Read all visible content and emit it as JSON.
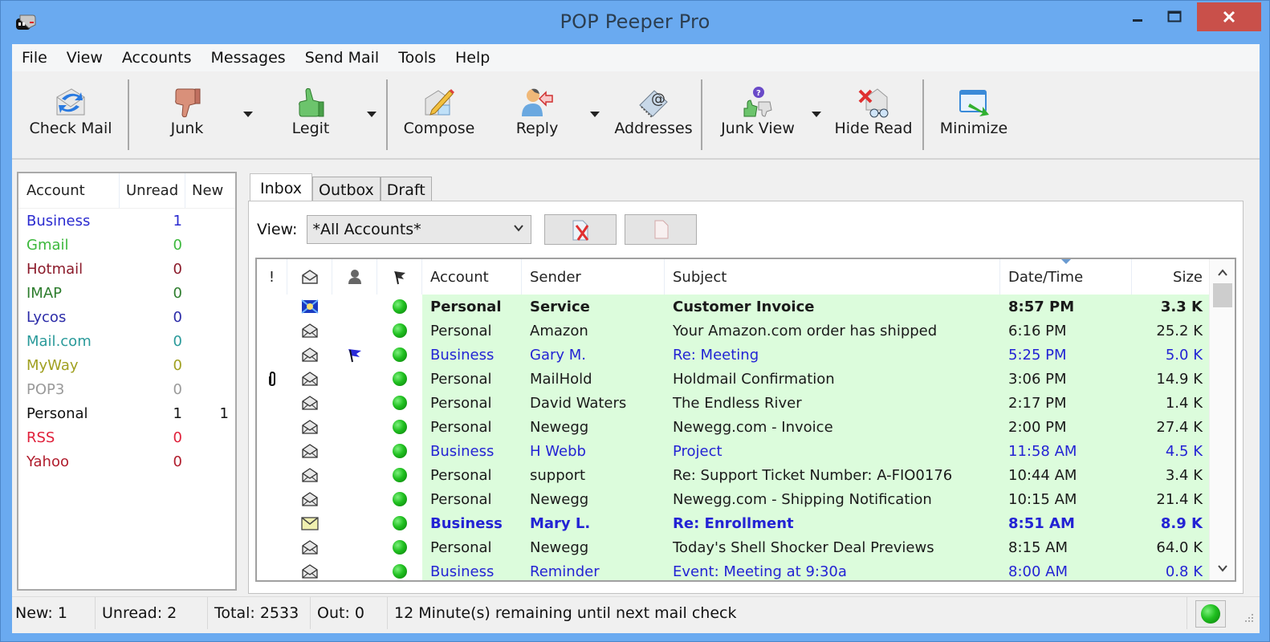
{
  "window": {
    "title": "POP Peeper Pro",
    "controls": {
      "minimize": "minimize",
      "maximize": "maximize",
      "close": "close"
    }
  },
  "menu": [
    "File",
    "View",
    "Accounts",
    "Messages",
    "Send Mail",
    "Tools",
    "Help"
  ],
  "toolbar": {
    "buttons": [
      {
        "label": "Check Mail",
        "icon": "check-mail-icon"
      },
      {
        "label": "Junk",
        "icon": "thumbs-down-icon",
        "dropdown": true
      },
      {
        "label": "Legit",
        "icon": "thumbs-up-icon",
        "dropdown": true
      },
      {
        "label": "Compose",
        "icon": "compose-icon"
      },
      {
        "label": "Reply",
        "icon": "reply-icon",
        "dropdown": true
      },
      {
        "label": "Addresses",
        "icon": "address-book-icon"
      },
      {
        "label": "Junk View",
        "icon": "junk-view-icon",
        "dropdown": true
      },
      {
        "label": "Hide Read",
        "icon": "hide-read-icon"
      },
      {
        "label": "Minimize",
        "icon": "minimize-to-tray-icon"
      }
    ]
  },
  "accounts_panel": {
    "headers": {
      "account": "Account",
      "unread": "Unread",
      "new": "New"
    },
    "rows": [
      {
        "name": "Business",
        "unread": "1",
        "new": "",
        "color": "#2b2bd0"
      },
      {
        "name": "Gmail",
        "unread": "0",
        "new": "",
        "color": "#3cb83c"
      },
      {
        "name": "Hotmail",
        "unread": "0",
        "new": "",
        "color": "#8b1a2a"
      },
      {
        "name": "IMAP",
        "unread": "0",
        "new": "",
        "color": "#2e7d2e"
      },
      {
        "name": "Lycos",
        "unread": "0",
        "new": "",
        "color": "#2b2ba8"
      },
      {
        "name": "Mail.com",
        "unread": "0",
        "new": "",
        "color": "#2a9a9a"
      },
      {
        "name": "MyWay",
        "unread": "0",
        "new": "",
        "color": "#a0a020"
      },
      {
        "name": "POP3",
        "unread": "0",
        "new": "",
        "color": "#9a9a9a"
      },
      {
        "name": "Personal",
        "unread": "1",
        "new": "1",
        "color": "#111111"
      },
      {
        "name": "RSS",
        "unread": "0",
        "new": "",
        "color": "#e0203a"
      },
      {
        "name": "Yahoo",
        "unread": "0",
        "new": "",
        "color": "#b01c2c"
      }
    ]
  },
  "tabs": [
    {
      "label": "Inbox",
      "active": true
    },
    {
      "label": "Outbox",
      "active": false
    },
    {
      "label": "Draft",
      "active": false
    }
  ],
  "view": {
    "label": "View:",
    "selected": "*All Accounts*"
  },
  "view_buttons": [
    {
      "icon": "delete-message-icon"
    },
    {
      "icon": "blank-page-icon"
    }
  ],
  "grid": {
    "headers": {
      "priority": "!",
      "status": "envelope-icon",
      "person": "person-icon",
      "flag": "flag-icon",
      "account": "Account",
      "sender": "Sender",
      "subject": "Subject",
      "date": "Date/Time",
      "size": "Size"
    },
    "sort_column": "date",
    "rows": [
      {
        "attach": false,
        "status": "new",
        "flagged": false,
        "account": "Personal",
        "sender": "Service",
        "subject": "Customer Invoice",
        "date": "8:57 PM",
        "size": "3.3 K",
        "style": "bold"
      },
      {
        "attach": false,
        "status": "read",
        "flagged": false,
        "account": "Personal",
        "sender": "Amazon",
        "subject": "Your Amazon.com order has shipped",
        "date": "6:16 PM",
        "size": "25.2 K",
        "style": "normal"
      },
      {
        "attach": false,
        "status": "read",
        "flagged": true,
        "account": "Business",
        "sender": "Gary M.",
        "subject": "Re: Meeting",
        "date": "5:25 PM",
        "size": "5.0 K",
        "style": "blue"
      },
      {
        "attach": true,
        "status": "read",
        "flagged": false,
        "account": "Personal",
        "sender": "MailHold",
        "subject": "Holdmail Confirmation",
        "date": "3:06 PM",
        "size": "14.9 K",
        "style": "normal"
      },
      {
        "attach": false,
        "status": "read",
        "flagged": false,
        "account": "Personal",
        "sender": "David Waters",
        "subject": "The Endless River",
        "date": "2:17 PM",
        "size": "1.4 K",
        "style": "normal"
      },
      {
        "attach": false,
        "status": "read",
        "flagged": false,
        "account": "Personal",
        "sender": "Newegg",
        "subject": "Newegg.com - Invoice",
        "date": "2:00 PM",
        "size": "27.4 K",
        "style": "normal"
      },
      {
        "attach": false,
        "status": "read",
        "flagged": false,
        "account": "Business",
        "sender": "H Webb",
        "subject": "Project",
        "date": "11:58 AM",
        "size": "4.5 K",
        "style": "blue"
      },
      {
        "attach": false,
        "status": "read",
        "flagged": false,
        "account": "Personal",
        "sender": "support",
        "subject": "Re: Support Ticket Number: A-FIO0176",
        "date": "10:44 AM",
        "size": "3.4 K",
        "style": "normal"
      },
      {
        "attach": false,
        "status": "read",
        "flagged": false,
        "account": "Personal",
        "sender": "Newegg",
        "subject": "Newegg.com - Shipping Notification",
        "date": "10:15 AM",
        "size": "21.4 K",
        "style": "normal"
      },
      {
        "attach": false,
        "status": "unread",
        "flagged": false,
        "account": "Business",
        "sender": "Mary L.",
        "subject": "Re: Enrollment",
        "date": "8:51 AM",
        "size": "8.9 K",
        "style": "bold-blue"
      },
      {
        "attach": false,
        "status": "read",
        "flagged": false,
        "account": "Personal",
        "sender": "Newegg",
        "subject": "Today's Shell Shocker Deal Previews",
        "date": "8:15 AM",
        "size": "64.0 K",
        "style": "normal"
      },
      {
        "attach": false,
        "status": "read",
        "flagged": false,
        "account": "Business",
        "sender": "Reminder",
        "subject": "Event: Meeting at 9:30a",
        "date": "8:00 AM",
        "size": "0.8 K",
        "style": "blue"
      }
    ]
  },
  "statusbar": {
    "new": "New: 1",
    "unread": "Unread: 2",
    "total": "Total: 2533",
    "out": "Out: 0",
    "message": "12 Minute(s) remaining until next mail check",
    "connection_status": "online"
  },
  "colors": {
    "titlebar": "#6aaaf0",
    "close_button": "#c9504a",
    "row_highlight": "#dcfcdc",
    "business_blue": "#2323d4"
  }
}
